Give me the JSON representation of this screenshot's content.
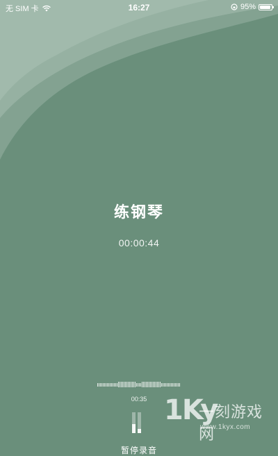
{
  "status_bar": {
    "carrier": "无 SIM 卡",
    "time": "16:27",
    "battery_percent": "95%",
    "battery_level": 0.95,
    "icons": [
      "wifi-icon",
      "rotation-lock-icon",
      "battery-icon"
    ]
  },
  "recording": {
    "title": "练钢琴",
    "timer": "00:00:44",
    "elapsed": "00:35",
    "level_meter": [
      0.45,
      0.2
    ],
    "pause_label": "暂停录音"
  },
  "watermark": {
    "logo": "1kyx",
    "name": "一刻游戏网",
    "url": "www.1kyx.com"
  },
  "colors": {
    "background": "#6a8f7b",
    "wave_light": "#98b3a4",
    "text": "#ffffff"
  }
}
